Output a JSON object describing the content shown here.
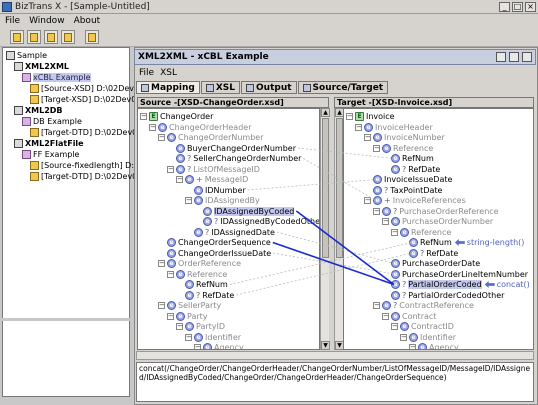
{
  "window": {
    "title": "BizTrans X - [Sample-Untitled]",
    "buttons": {
      "min": "_",
      "max": "□",
      "close": "×"
    }
  },
  "menu": {
    "file": "File",
    "window": "Window",
    "about": "About"
  },
  "project_tree": {
    "root": "Sample",
    "items": [
      {
        "label": "XML2XML",
        "level": 1,
        "bold": true
      },
      {
        "label": "xCBL Example",
        "level": 2,
        "selected": true
      },
      {
        "label": "[Source-XSD] D:\\02Dev0",
        "level": 3
      },
      {
        "label": "[Target-XSD] D:\\02Dev0",
        "level": 3
      },
      {
        "label": "XML2DB",
        "level": 1,
        "bold": true
      },
      {
        "label": "DB Example",
        "level": 2
      },
      {
        "label": "[Target-DTD] D:\\02Dev0",
        "level": 3
      },
      {
        "label": "XML2FlatFile",
        "level": 1,
        "bold": true
      },
      {
        "label": "FF Example",
        "level": 2
      },
      {
        "label": "[Source-fixedlength] D:\\",
        "level": 3
      },
      {
        "label": "[Target-DTD] D:\\02Dev0",
        "level": 3
      }
    ]
  },
  "frame": {
    "title": "XML2XML - xCBL Example",
    "menu_file": "File",
    "menu_xsl": "XSL"
  },
  "tabs": [
    "Mapping",
    "XSL",
    "Output",
    "Source/Target"
  ],
  "source": {
    "header": "Source -[XSD-ChangeOrder.xsd]",
    "rows": [
      {
        "label": "ChangeOrder",
        "d": 0,
        "k": "root"
      },
      {
        "label": "ChangeOrderHeader",
        "d": 1,
        "grey": true
      },
      {
        "label": "ChangeOrderNumber",
        "d": 2,
        "grey": true
      },
      {
        "label": "BuyerChangeOrderNumber",
        "d": 3
      },
      {
        "label": "SellerChangeOrderNumber",
        "d": 3,
        "q": true
      },
      {
        "label": "ListOfMessageID",
        "d": 3,
        "q": true,
        "grey": true
      },
      {
        "label": "MessageID",
        "d": 4,
        "plus": true,
        "grey": true
      },
      {
        "label": "IDNumber",
        "d": 5
      },
      {
        "label": "IDAssignedBy",
        "d": 5,
        "grey": true
      },
      {
        "label": "IDAssignedByCoded",
        "d": 6,
        "sel": true
      },
      {
        "label": "IDAssignedByCodedOther",
        "d": 6,
        "q": true
      },
      {
        "label": "IDAssignedDate",
        "d": 5,
        "q": true
      },
      {
        "label": "ChangeOrderSequence",
        "d": 2
      },
      {
        "label": "ChangeOrderIssueDate",
        "d": 2
      },
      {
        "label": "OrderReference",
        "d": 2,
        "grey": true
      },
      {
        "label": "Reference",
        "d": 3,
        "grey": true
      },
      {
        "label": "RefNum",
        "d": 4
      },
      {
        "label": "RefDate",
        "d": 4,
        "q": true
      },
      {
        "label": "SellerParty",
        "d": 2,
        "grey": true
      },
      {
        "label": "Party",
        "d": 3,
        "grey": true
      },
      {
        "label": "PartyID",
        "d": 4,
        "grey": true
      },
      {
        "label": "Identifier",
        "d": 5,
        "grey": true
      },
      {
        "label": "Agency",
        "d": 6,
        "grey": true
      }
    ]
  },
  "target": {
    "header": "Target -[XSD-Invoice.xsd]",
    "rows": [
      {
        "label": "Invoice",
        "d": 0,
        "k": "root"
      },
      {
        "label": "InvoiceHeader",
        "d": 1,
        "grey": true
      },
      {
        "label": "InvoiceNumber",
        "d": 2,
        "grey": true
      },
      {
        "label": "Reference",
        "d": 3,
        "grey": true
      },
      {
        "label": "RefNum",
        "d": 4
      },
      {
        "label": "RefDate",
        "d": 4,
        "q": true
      },
      {
        "label": "InvoiceIssueDate",
        "d": 2
      },
      {
        "label": "TaxPointDate",
        "d": 2,
        "q": true
      },
      {
        "label": "InvoiceReferences",
        "d": 2,
        "plus": true,
        "grey": true
      },
      {
        "label": "PurchaseOrderReference",
        "d": 3,
        "q": true,
        "grey": true
      },
      {
        "label": "PurchaseOrderNumber",
        "d": 4,
        "grey": true
      },
      {
        "label": "Reference",
        "d": 5,
        "grey": true
      },
      {
        "label": "RefNum",
        "d": 6,
        "fn": "string-length()"
      },
      {
        "label": "RefDate",
        "d": 6,
        "q": true
      },
      {
        "label": "PurchaseOrderDate",
        "d": 4
      },
      {
        "label": "PurchaseOrderLineItemNumber",
        "d": 4
      },
      {
        "label": "PartialOrderCoded",
        "d": 4,
        "q": true,
        "sel": true,
        "fn": "concat()"
      },
      {
        "label": "PartialOrderCodedOther",
        "d": 4,
        "q": true
      },
      {
        "label": "ContractReference",
        "d": 3,
        "q": true,
        "grey": true
      },
      {
        "label": "Contract",
        "d": 4,
        "grey": true
      },
      {
        "label": "ContractID",
        "d": 5,
        "grey": true
      },
      {
        "label": "Identifier",
        "d": 6,
        "grey": true
      },
      {
        "label": "Agency",
        "d": 7,
        "grey": true
      }
    ]
  },
  "formula": "concat(/ChangeOrder/ChangeOrderHeader/ChangeOrderNumber/ListOfMessageID/MessageID/IDAssigned/IDAssignedByCoded/ChangeOrder/ChangeOrderHeader/ChangeOrderSequence)",
  "colors": {
    "accent": "#1a2ad0",
    "node": "#9aa6e8",
    "selection": "#c4c8ee"
  }
}
